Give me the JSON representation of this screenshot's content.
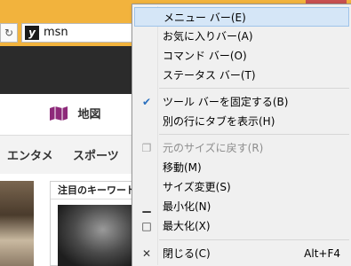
{
  "browser": {
    "close_glyph": "✕",
    "refresh_glyph": "↻",
    "favicon_text": "y",
    "address_text": "msn",
    "accent_color": "#f2b33d"
  },
  "page": {
    "map_link": "地図",
    "categories": [
      "エンタメ",
      "スポーツ"
    ],
    "keyword_panel_title": "注目のキーワード"
  },
  "context_menu": {
    "items": [
      {
        "label": "メニュー バー(E)",
        "shortcut": "",
        "icon": "",
        "highlighted": true,
        "disabled": false
      },
      {
        "label": "お気に入りバー(A)",
        "shortcut": "",
        "icon": "",
        "highlighted": false,
        "disabled": false
      },
      {
        "label": "コマンド バー(O)",
        "shortcut": "",
        "icon": "",
        "highlighted": false,
        "disabled": false
      },
      {
        "label": "ステータス バー(T)",
        "shortcut": "",
        "icon": "",
        "highlighted": false,
        "disabled": false
      },
      {
        "label": "ツール バーを固定する(B)",
        "shortcut": "",
        "icon": "✔",
        "highlighted": false,
        "disabled": false
      },
      {
        "label": "別の行にタブを表示(H)",
        "shortcut": "",
        "icon": "",
        "highlighted": false,
        "disabled": false
      },
      {
        "label": "元のサイズに戻す(R)",
        "shortcut": "",
        "icon": "❐",
        "highlighted": false,
        "disabled": true
      },
      {
        "label": "移動(M)",
        "shortcut": "",
        "icon": "",
        "highlighted": false,
        "disabled": false
      },
      {
        "label": "サイズ変更(S)",
        "shortcut": "",
        "icon": "",
        "highlighted": false,
        "disabled": false
      },
      {
        "label": "最小化(N)",
        "shortcut": "",
        "icon": "▁",
        "highlighted": false,
        "disabled": false
      },
      {
        "label": "最大化(X)",
        "shortcut": "",
        "icon": "□",
        "highlighted": false,
        "disabled": false
      },
      {
        "label": "閉じる(C)",
        "shortcut": "Alt+F4",
        "icon": "✕",
        "highlighted": false,
        "disabled": false
      }
    ]
  }
}
